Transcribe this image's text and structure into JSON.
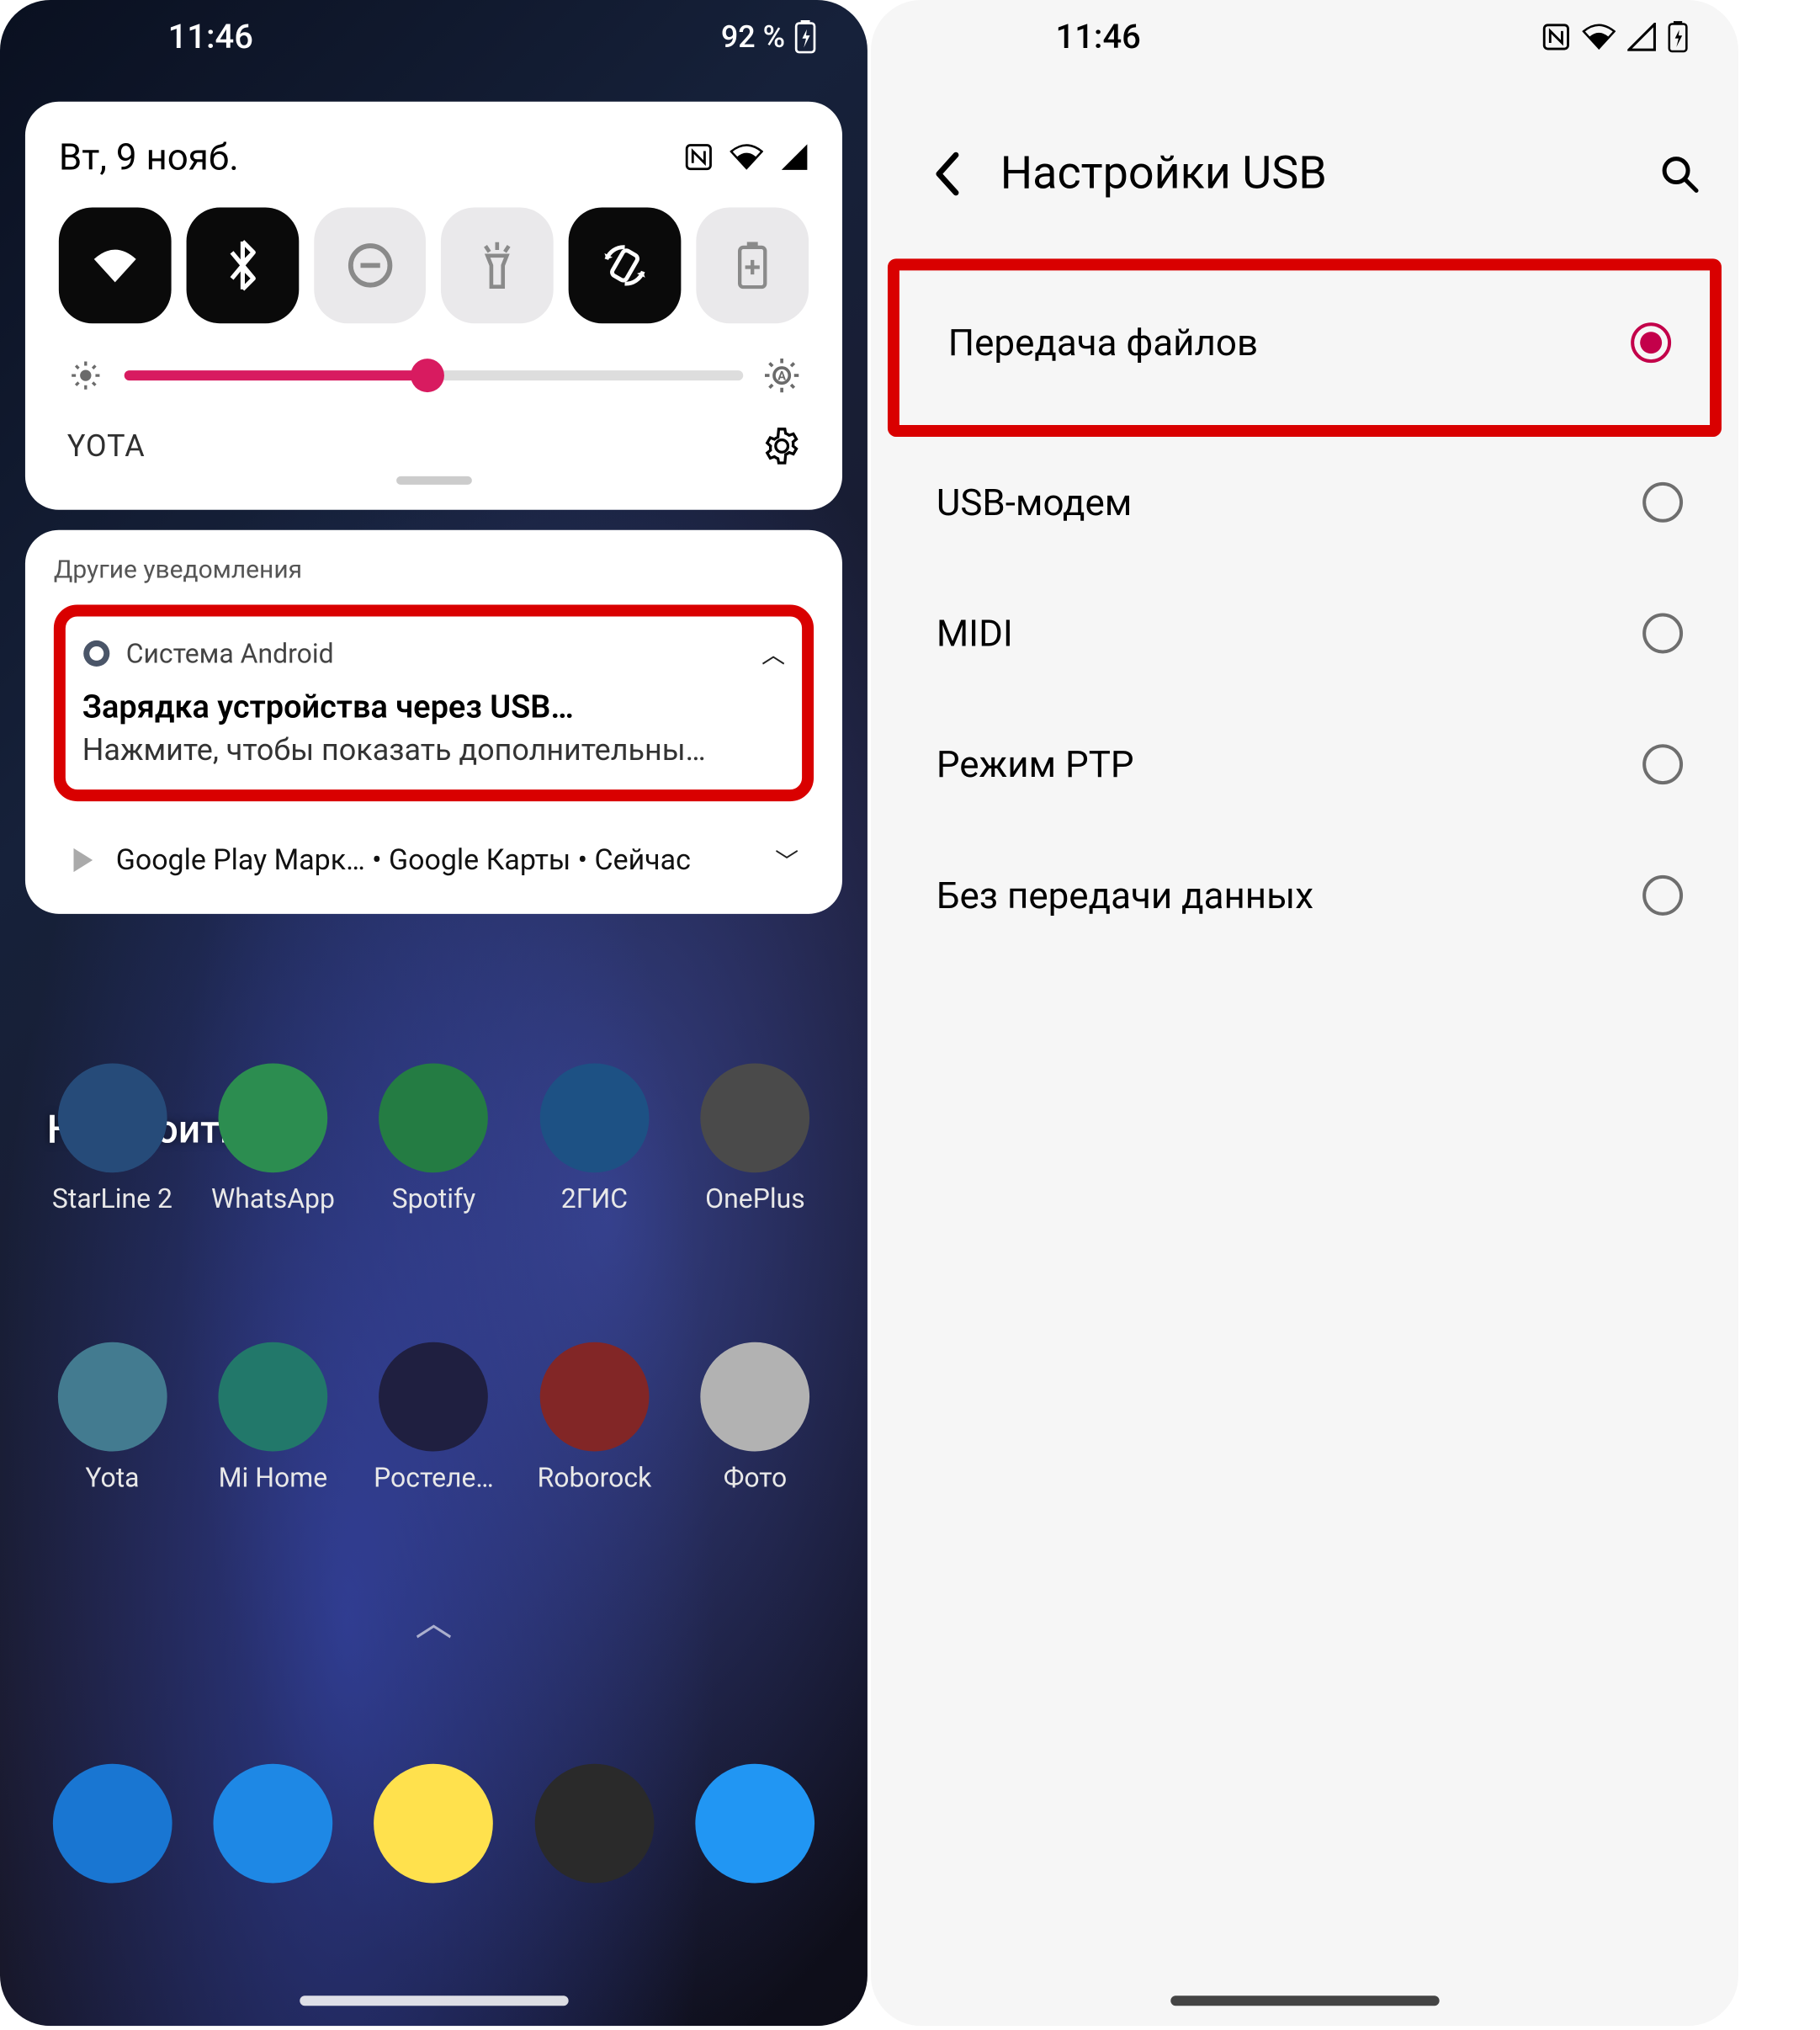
{
  "left": {
    "status": {
      "time": "11:46",
      "battery": "92 %"
    },
    "qs": {
      "date": "Вт, 9 нояб.",
      "tiles": [
        "wifi",
        "bluetooth",
        "dnd",
        "flashlight",
        "rotate",
        "battery-saver"
      ]
    },
    "brightness_percent": 49,
    "carrier": "YOTA",
    "other_label": "Другие уведомления",
    "notif1": {
      "source": "Система Android",
      "title": "Зарядка устройства через USB…",
      "body": "Нажмите, чтобы показать дополнительны…"
    },
    "notif2": {
      "text": "Google Play Марк… • Google Карты • Сейчас"
    },
    "edit_label": "Настроить",
    "apps_row1": [
      {
        "label": "StarLine 2",
        "bg": "#2b6dbf"
      },
      {
        "label": "WhatsApp",
        "bg": "#25d366"
      },
      {
        "label": "Spotify",
        "bg": "#1db954"
      },
      {
        "label": "2ГИС",
        "bg": "#1976d2"
      },
      {
        "label": "OnePlus",
        "bg": "#6a6a6a"
      }
    ],
    "apps_row2": [
      {
        "label": "Yota",
        "bg": "#4fb3d9"
      },
      {
        "label": "Mi Home",
        "bg": "#19b39a"
      },
      {
        "label": "Ростеле…",
        "bg": "#2b2b66"
      },
      {
        "label": "Roborock",
        "bg": "#d32f2f"
      },
      {
        "label": "Фото",
        "bg": "#ffffff"
      }
    ],
    "dock": [
      {
        "name": "phone",
        "bg": "#1976d2"
      },
      {
        "name": "messages",
        "bg": "#1e88e5"
      },
      {
        "name": "yandex",
        "bg": "#ffe14d"
      },
      {
        "name": "camera",
        "bg": "#2a2a2a"
      },
      {
        "name": "weather",
        "bg": "#2196f3"
      }
    ]
  },
  "right": {
    "status": {
      "time": "11:46"
    },
    "title": "Настройки USB",
    "options": [
      {
        "label": "Передача файлов",
        "selected": true,
        "highlight": true
      },
      {
        "label": "USB-модем",
        "selected": false
      },
      {
        "label": "MIDI",
        "selected": false
      },
      {
        "label": "Режим PTP",
        "selected": false
      },
      {
        "label": "Без передачи данных",
        "selected": false
      }
    ]
  }
}
